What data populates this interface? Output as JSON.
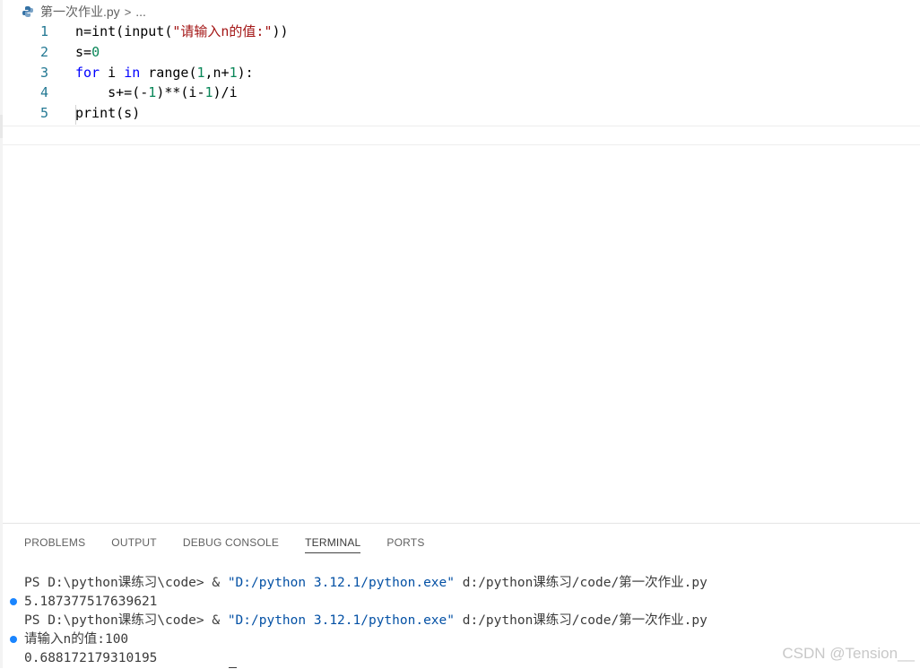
{
  "breadcrumb": {
    "file": "第一次作业.py",
    "separator": ">",
    "more": "..."
  },
  "editor": {
    "lines": [
      {
        "num": "1",
        "parts": [
          {
            "t": "n=",
            "c": "plain"
          },
          {
            "t": "int",
            "c": "plain"
          },
          {
            "t": "(",
            "c": "plain"
          },
          {
            "t": "input",
            "c": "plain"
          },
          {
            "t": "(",
            "c": "plain"
          },
          {
            "t": "\"请输入n的值:\"",
            "c": "str"
          },
          {
            "t": "))",
            "c": "plain"
          }
        ]
      },
      {
        "num": "2",
        "parts": [
          {
            "t": "s=",
            "c": "plain"
          },
          {
            "t": "0",
            "c": "num"
          }
        ]
      },
      {
        "num": "3",
        "parts": [
          {
            "t": "for",
            "c": "kw"
          },
          {
            "t": " i ",
            "c": "plain"
          },
          {
            "t": "in",
            "c": "kw"
          },
          {
            "t": " ",
            "c": "plain"
          },
          {
            "t": "range",
            "c": "plain"
          },
          {
            "t": "(",
            "c": "plain"
          },
          {
            "t": "1",
            "c": "num"
          },
          {
            "t": ",n+",
            "c": "plain"
          },
          {
            "t": "1",
            "c": "num"
          },
          {
            "t": "):",
            "c": "plain"
          }
        ]
      },
      {
        "num": "4",
        "parts": [
          {
            "t": "    s+=(-",
            "c": "plain"
          },
          {
            "t": "1",
            "c": "num"
          },
          {
            "t": ")**(i-",
            "c": "plain"
          },
          {
            "t": "1",
            "c": "num"
          },
          {
            "t": ")/i",
            "c": "plain"
          }
        ]
      },
      {
        "num": "5",
        "parts": [
          {
            "t": "print",
            "c": "plain"
          },
          {
            "t": "(s)",
            "c": "plain"
          }
        ]
      }
    ]
  },
  "panel": {
    "tabs": [
      {
        "label": "PROBLEMS",
        "active": false
      },
      {
        "label": "OUTPUT",
        "active": false
      },
      {
        "label": "DEBUG CONSOLE",
        "active": false
      },
      {
        "label": "TERMINAL",
        "active": true
      },
      {
        "label": "PORTS",
        "active": false
      }
    ]
  },
  "terminal": {
    "line1_prefix": "PS D:\\python课练习\\code> & ",
    "line1_exe": "\"D:/python 3.12.1/python.exe\"",
    "line1_script": " d:/python课练习/code/第一次作业.py",
    "line2": "5.187377517639621",
    "line3_prefix": "PS D:\\python课练习\\code> & ",
    "line3_exe": "\"D:/python 3.12.1/python.exe\"",
    "line3_script": " d:/python课练习/code/第一次作业.py",
    "line4": "请输入n的值:100",
    "line5": "0.688172179310195"
  },
  "watermark": "CSDN @Tension__",
  "colors": {
    "keyword": "#0000ff",
    "number": "#098658",
    "string": "#a31515",
    "line_number": "#237893",
    "terminal_path": "#0451a5",
    "status_dot": "#1a85ff"
  }
}
